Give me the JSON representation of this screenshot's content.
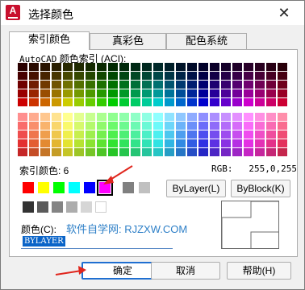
{
  "window": {
    "title": "选择颜色",
    "close_glyph": "✕"
  },
  "app_icon": {
    "letter": "A",
    "name": "autocad-app-icon"
  },
  "tabs": [
    {
      "label": "索引颜色",
      "active": true
    },
    {
      "label": "真彩色",
      "active": false
    },
    {
      "label": "配色系统",
      "active": false
    }
  ],
  "aci": {
    "label_prefix": "AutoCAD",
    "label_suffix": " 颜色索引 (ACI):"
  },
  "index": {
    "label": "索引颜色: 6"
  },
  "rgb": {
    "label": "RGB:",
    "value": "255,0,255"
  },
  "standard_colors": [
    "#ff0000",
    "#ffff00",
    "#00ff00",
    "#00ffff",
    "#0000ff",
    "#ff00ff"
  ],
  "selected_standard_index": 5,
  "gray_colors": [
    "#808080",
    "#c0c0c0",
    "#333333",
    "#5b5b5b",
    "#848484",
    "#adadad",
    "#d6d6d6",
    "#ffffff"
  ],
  "buttons": {
    "bylayer": "ByLayer(L)",
    "byblock": "ByBlock(K)"
  },
  "color_field": {
    "label": "颜色(C):",
    "value": "BYLAYER"
  },
  "watermark": "软件自学网: RJZXW.COM",
  "footer": {
    "ok": "确定",
    "cancel": "取消",
    "help": "帮助(H)"
  },
  "annotation_color": "#e0261d"
}
